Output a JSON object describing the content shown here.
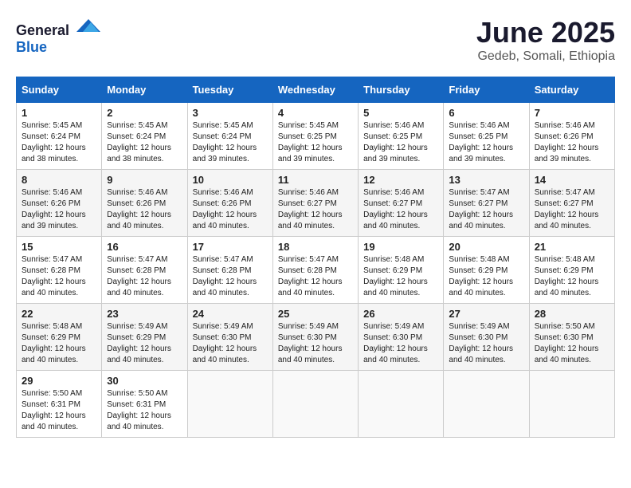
{
  "logo": {
    "general": "General",
    "blue": "Blue"
  },
  "title": "June 2025",
  "subtitle": "Gedeb, Somali, Ethiopia",
  "days": [
    "Sunday",
    "Monday",
    "Tuesday",
    "Wednesday",
    "Thursday",
    "Friday",
    "Saturday"
  ],
  "weeks": [
    [
      {
        "day": "1",
        "sunrise": "5:45 AM",
        "sunset": "6:24 PM",
        "daylight": "12 hours and 38 minutes."
      },
      {
        "day": "2",
        "sunrise": "5:45 AM",
        "sunset": "6:24 PM",
        "daylight": "12 hours and 38 minutes."
      },
      {
        "day": "3",
        "sunrise": "5:45 AM",
        "sunset": "6:24 PM",
        "daylight": "12 hours and 39 minutes."
      },
      {
        "day": "4",
        "sunrise": "5:45 AM",
        "sunset": "6:25 PM",
        "daylight": "12 hours and 39 minutes."
      },
      {
        "day": "5",
        "sunrise": "5:46 AM",
        "sunset": "6:25 PM",
        "daylight": "12 hours and 39 minutes."
      },
      {
        "day": "6",
        "sunrise": "5:46 AM",
        "sunset": "6:25 PM",
        "daylight": "12 hours and 39 minutes."
      },
      {
        "day": "7",
        "sunrise": "5:46 AM",
        "sunset": "6:26 PM",
        "daylight": "12 hours and 39 minutes."
      }
    ],
    [
      {
        "day": "8",
        "sunrise": "5:46 AM",
        "sunset": "6:26 PM",
        "daylight": "12 hours and 39 minutes."
      },
      {
        "day": "9",
        "sunrise": "5:46 AM",
        "sunset": "6:26 PM",
        "daylight": "12 hours and 40 minutes."
      },
      {
        "day": "10",
        "sunrise": "5:46 AM",
        "sunset": "6:26 PM",
        "daylight": "12 hours and 40 minutes."
      },
      {
        "day": "11",
        "sunrise": "5:46 AM",
        "sunset": "6:27 PM",
        "daylight": "12 hours and 40 minutes."
      },
      {
        "day": "12",
        "sunrise": "5:46 AM",
        "sunset": "6:27 PM",
        "daylight": "12 hours and 40 minutes."
      },
      {
        "day": "13",
        "sunrise": "5:47 AM",
        "sunset": "6:27 PM",
        "daylight": "12 hours and 40 minutes."
      },
      {
        "day": "14",
        "sunrise": "5:47 AM",
        "sunset": "6:27 PM",
        "daylight": "12 hours and 40 minutes."
      }
    ],
    [
      {
        "day": "15",
        "sunrise": "5:47 AM",
        "sunset": "6:28 PM",
        "daylight": "12 hours and 40 minutes."
      },
      {
        "day": "16",
        "sunrise": "5:47 AM",
        "sunset": "6:28 PM",
        "daylight": "12 hours and 40 minutes."
      },
      {
        "day": "17",
        "sunrise": "5:47 AM",
        "sunset": "6:28 PM",
        "daylight": "12 hours and 40 minutes."
      },
      {
        "day": "18",
        "sunrise": "5:47 AM",
        "sunset": "6:28 PM",
        "daylight": "12 hours and 40 minutes."
      },
      {
        "day": "19",
        "sunrise": "5:48 AM",
        "sunset": "6:29 PM",
        "daylight": "12 hours and 40 minutes."
      },
      {
        "day": "20",
        "sunrise": "5:48 AM",
        "sunset": "6:29 PM",
        "daylight": "12 hours and 40 minutes."
      },
      {
        "day": "21",
        "sunrise": "5:48 AM",
        "sunset": "6:29 PM",
        "daylight": "12 hours and 40 minutes."
      }
    ],
    [
      {
        "day": "22",
        "sunrise": "5:48 AM",
        "sunset": "6:29 PM",
        "daylight": "12 hours and 40 minutes."
      },
      {
        "day": "23",
        "sunrise": "5:49 AM",
        "sunset": "6:29 PM",
        "daylight": "12 hours and 40 minutes."
      },
      {
        "day": "24",
        "sunrise": "5:49 AM",
        "sunset": "6:30 PM",
        "daylight": "12 hours and 40 minutes."
      },
      {
        "day": "25",
        "sunrise": "5:49 AM",
        "sunset": "6:30 PM",
        "daylight": "12 hours and 40 minutes."
      },
      {
        "day": "26",
        "sunrise": "5:49 AM",
        "sunset": "6:30 PM",
        "daylight": "12 hours and 40 minutes."
      },
      {
        "day": "27",
        "sunrise": "5:49 AM",
        "sunset": "6:30 PM",
        "daylight": "12 hours and 40 minutes."
      },
      {
        "day": "28",
        "sunrise": "5:50 AM",
        "sunset": "6:30 PM",
        "daylight": "12 hours and 40 minutes."
      }
    ],
    [
      {
        "day": "29",
        "sunrise": "5:50 AM",
        "sunset": "6:31 PM",
        "daylight": "12 hours and 40 minutes."
      },
      {
        "day": "30",
        "sunrise": "5:50 AM",
        "sunset": "6:31 PM",
        "daylight": "12 hours and 40 minutes."
      },
      null,
      null,
      null,
      null,
      null
    ]
  ],
  "labels": {
    "sunrise": "Sunrise:",
    "sunset": "Sunset:",
    "daylight": "Daylight:"
  }
}
